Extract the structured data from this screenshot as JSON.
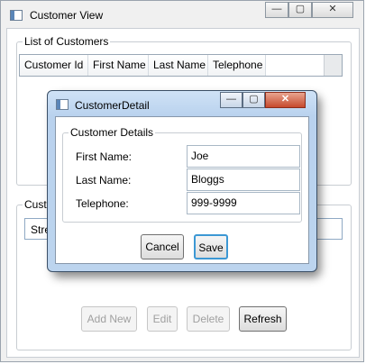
{
  "main_window": {
    "title": "Customer View",
    "icon": "window-app-icon",
    "caption_buttons": {
      "minimize": "—",
      "maximize": "▢",
      "close": "✕"
    }
  },
  "customer_list": {
    "group_label": "List of Customers",
    "columns": [
      "Customer Id",
      "First Name",
      "Last Name",
      "Telephone"
    ]
  },
  "customer_group": {
    "label_partial": "Custo",
    "street_partial": "Stre"
  },
  "actions": {
    "add_new": "Add New",
    "edit": "Edit",
    "delete": "Delete",
    "refresh": "Refresh"
  },
  "dialog": {
    "title": "CustomerDetail",
    "icon": "window-app-icon",
    "caption_buttons": {
      "minimize": "—",
      "maximize": "▢",
      "close": "✕"
    },
    "group_label": "Customer Details",
    "fields": [
      {
        "label": "First Name:",
        "value": "Joe"
      },
      {
        "label": "Last Name:",
        "value": "Bloggs"
      },
      {
        "label": "Telephone:",
        "value": "999-9999"
      }
    ],
    "cancel_label": "Cancel",
    "save_label": "Save"
  },
  "colors": {
    "dialog_title_gradient_top": "#cfe2f6",
    "dialog_close": "#c74a2d",
    "focus_border": "#3c98d4"
  }
}
